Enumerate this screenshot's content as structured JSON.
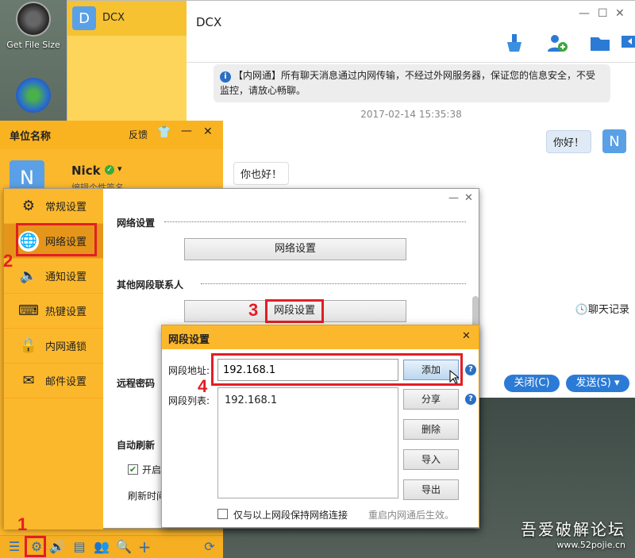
{
  "desktop": {
    "icons": [
      {
        "label": "Get File Size"
      }
    ],
    "watermark": {
      "title": "吾爱破解论坛",
      "url": "www.52pojie.cn"
    }
  },
  "chat": {
    "contact": {
      "avatar_letter": "D",
      "name": "DCX"
    },
    "title": "DCX",
    "notice": "【内网通】所有聊天消息通过内网传输，不经过外网服务器，保证您的信息安全，不受监控，请放心畅聊。",
    "timestamp": "2017-02-14 15:35:38",
    "messages": [
      {
        "from": "me",
        "text": "你好！",
        "avatar_letter": "N"
      },
      {
        "from": "other",
        "text": "你也好！"
      }
    ],
    "history_label": "聊天记录",
    "close_button": "关闭(C)",
    "send_button": "发送(S)"
  },
  "mainwin": {
    "title": "单位名称",
    "feedback": "反馈",
    "user": {
      "avatar_letter": "N",
      "name": "Nick",
      "signature": "编辑个性签名"
    }
  },
  "settings": {
    "nav": [
      {
        "label": "常规设置",
        "icon": "gear-icon"
      },
      {
        "label": "网络设置",
        "icon": "globe-icon"
      },
      {
        "label": "通知设置",
        "icon": "speaker-icon"
      },
      {
        "label": "热键设置",
        "icon": "keyboard-icon"
      },
      {
        "label": "内网通锁",
        "icon": "lock-icon"
      },
      {
        "label": "邮件设置",
        "icon": "mail-icon"
      }
    ],
    "network_section": "网络设置",
    "network_button": "网络设置",
    "other_section": "其他网段联系人",
    "segment_button": "网段设置",
    "remote_password": "远程密码",
    "auto_refresh": "自动刷新",
    "auto_refresh_enable": "开启",
    "refresh_time": "刷新时间"
  },
  "dialog": {
    "title": "网段设置",
    "address_label": "网段地址:",
    "address_value": "192.168.1",
    "list_label": "网段列表:",
    "list_items": [
      "192.168.1"
    ],
    "buttons": {
      "add": "添加",
      "share": "分享",
      "delete": "删除",
      "import": "导入",
      "export": "导出"
    },
    "keep_only_label": "仅与以上网段保持网络连接",
    "restart_note": "重启内网通后生效。"
  },
  "annotations": {
    "n1": "1",
    "n2": "2",
    "n3": "3",
    "n4": "4"
  }
}
